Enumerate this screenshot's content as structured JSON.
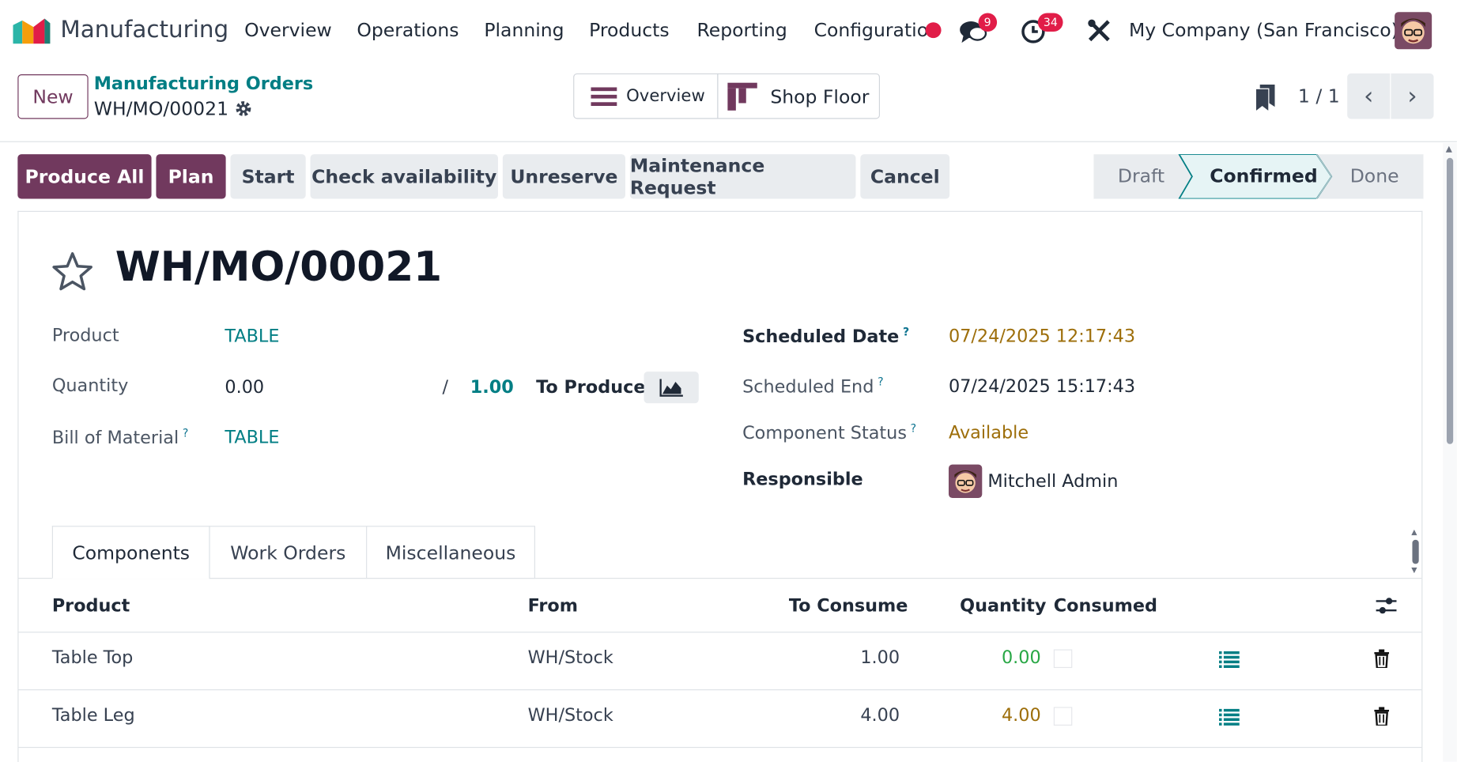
{
  "navbar": {
    "app_name": "Manufacturing",
    "menus": [
      "Overview",
      "Operations",
      "Planning",
      "Products",
      "Reporting",
      "Configuratio"
    ],
    "messages_count": "9",
    "activities_count": "34",
    "company": "My Company (San Francisco)"
  },
  "control_panel": {
    "new_label": "New",
    "breadcrumb_parent": "Manufacturing Orders",
    "breadcrumb_current": "WH/MO/00021",
    "view_overview": "Overview",
    "view_shop_floor": "Shop Floor",
    "pager": "1 / 1"
  },
  "actions": {
    "produce_all": "Produce All",
    "plan": "Plan",
    "start": "Start",
    "check_availability": "Check availability",
    "unreserve": "Unreserve",
    "maintenance_request": "Maintenance Request",
    "cancel": "Cancel"
  },
  "statusbar": {
    "draft": "Draft",
    "confirmed": "Confirmed",
    "done": "Done",
    "current": "Confirmed"
  },
  "form": {
    "title": "WH/MO/00021",
    "product_label": "Product",
    "product_value": "TABLE",
    "quantity_label": "Quantity",
    "quantity_value": "0.00",
    "quantity_sep": "/",
    "quantity_target": "1.00",
    "to_produce_label": "To Produce",
    "bom_label": "Bill of Material",
    "bom_value": "TABLE",
    "scheduled_date_label": "Scheduled Date",
    "scheduled_date_value": "07/24/2025 12:17:43",
    "scheduled_end_label": "Scheduled End",
    "scheduled_end_value": "07/24/2025 15:17:43",
    "component_status_label": "Component Status",
    "component_status_value": "Available",
    "responsible_label": "Responsible",
    "responsible_value": "Mitchell Admin",
    "help_mark": "?"
  },
  "tabs": [
    "Components",
    "Work Orders",
    "Miscellaneous"
  ],
  "components_table": {
    "headers": [
      "Product",
      "From",
      "To Consume",
      "Quantity",
      "Consumed"
    ],
    "rows": [
      {
        "product": "Table Top",
        "from": "WH/Stock",
        "to_consume": "1.00",
        "quantity": "0.00"
      },
      {
        "product": "Table Leg",
        "from": "WH/Stock",
        "to_consume": "4.00",
        "quantity": "4.00"
      }
    ]
  },
  "colors": {
    "brand": "#71395e",
    "link": "#017e84",
    "warning": "#9d6e0a",
    "success": "#28a745",
    "badge": "#e11d48"
  }
}
